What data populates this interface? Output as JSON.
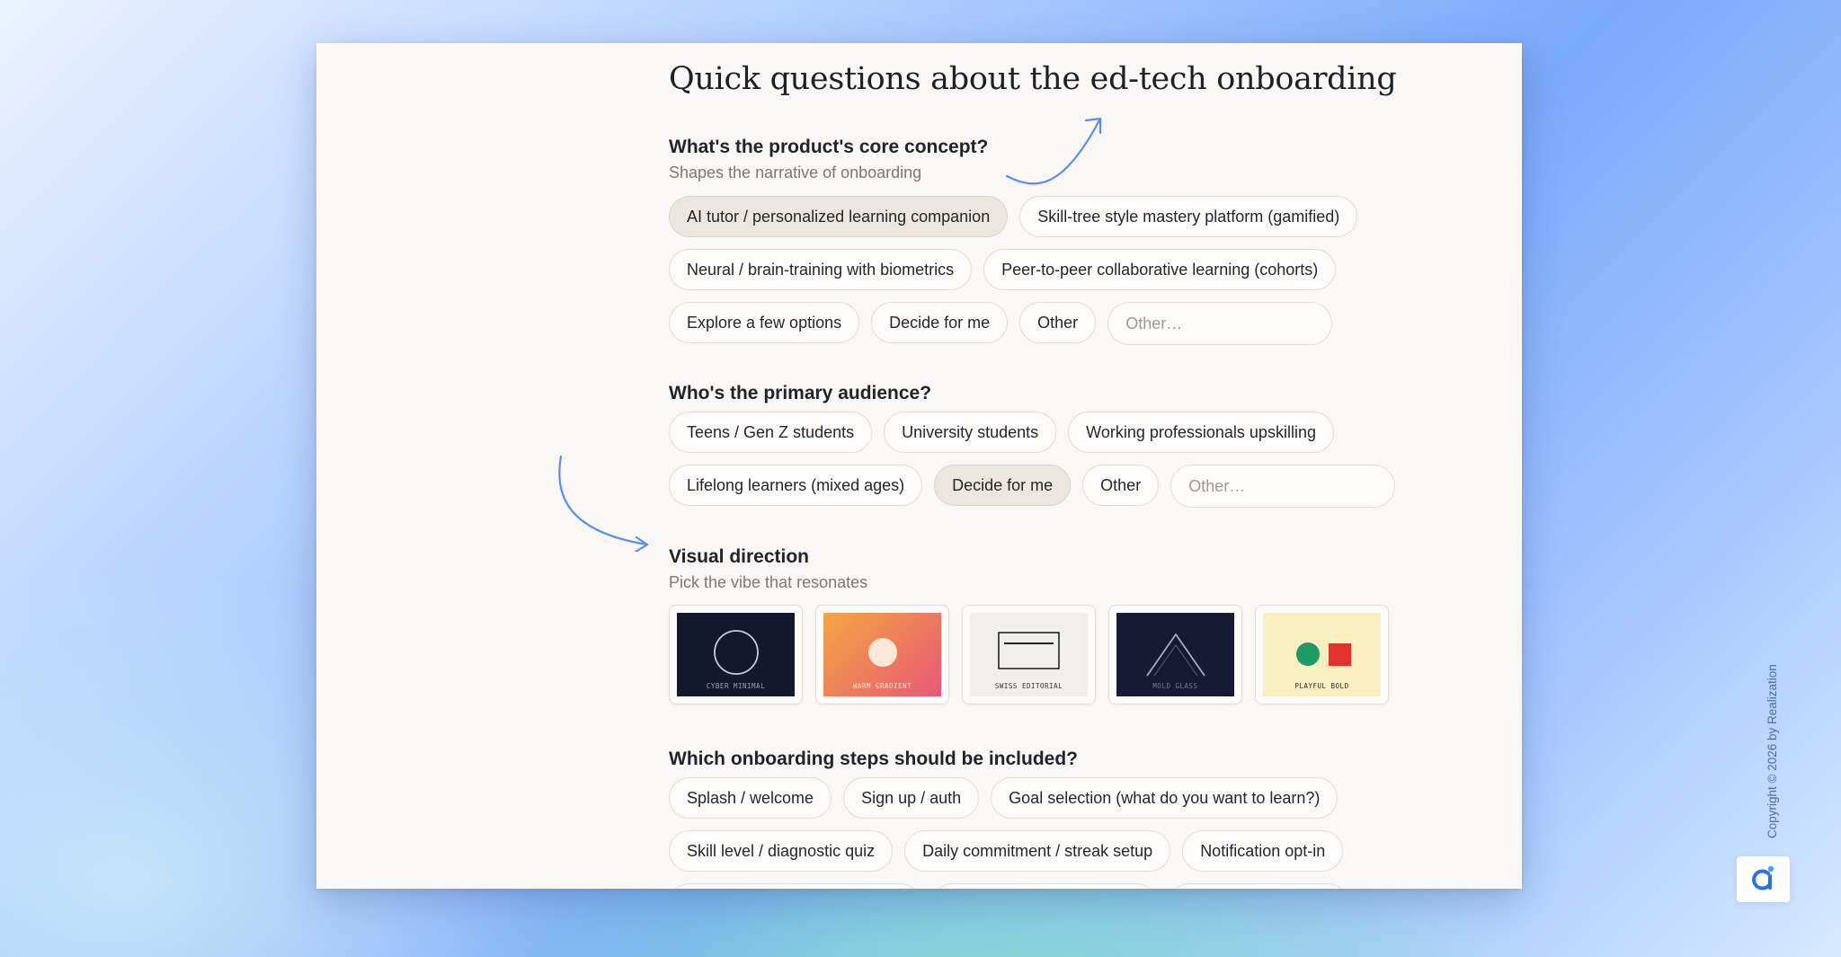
{
  "title": "Quick questions about the ed-tech onboarding",
  "questions": {
    "concept": {
      "title": "What's the product's core concept?",
      "subtitle": "Shapes the narrative of onboarding",
      "options": [
        "AI tutor / personalized learning companion",
        "Skill-tree style mastery platform (gamified)",
        "Neural / brain-training with biometrics",
        "Peer-to-peer collaborative learning (cohorts)",
        "Explore a few options",
        "Decide for me",
        "Other"
      ],
      "selected": "AI tutor / personalized learning companion",
      "other_placeholder": "Other…"
    },
    "audience": {
      "title": "Who's the primary audience?",
      "options": [
        "Teens / Gen Z students",
        "University students",
        "Working professionals upskilling",
        "Lifelong learners (mixed ages)",
        "Decide for me",
        "Other"
      ],
      "selected": "Decide for me",
      "other_placeholder": "Other…"
    },
    "visual": {
      "title": "Visual direction",
      "subtitle": "Pick the vibe that resonates",
      "styles": [
        {
          "label": "CYBER MINIMAL",
          "icon": "circle-outline",
          "bg": "#14182e",
          "fg": "#c9cbd6"
        },
        {
          "label": "WARM GRADIENT",
          "icon": "filled-circle",
          "bg_from": "#f5a646",
          "bg_to": "#e8587a",
          "fg": "#fde8d8"
        },
        {
          "label": "SWISS EDITORIAL",
          "icon": "rectangle-with-line",
          "bg": "#f1efed",
          "fg": "#222222"
        },
        {
          "label": "MOLD GLASS",
          "icon": "chevron-up",
          "bg": "#161a33",
          "fg": "#a7aab8"
        },
        {
          "label": "PLAYFUL BOLD",
          "icon": "circle-and-square",
          "bg": "#faefc1",
          "fg": "#2a2a2a",
          "circle": "#1e9a64",
          "square": "#e1332b"
        }
      ]
    },
    "steps": {
      "title": "Which onboarding steps should be included?",
      "options": [
        "Splash / welcome",
        "Sign up / auth",
        "Goal selection (what do you want to learn?)",
        "Skill level / diagnostic quiz",
        "Daily commitment / streak setup",
        "Notification opt-in"
      ]
    }
  },
  "copyright": "Copyright © 2026 by Realization",
  "colors": {
    "accent": "#5b8def",
    "selected_chip": "#ebe7e0",
    "window_bg": "#faf8f6"
  },
  "icons": {
    "decor_arrow_top": "curved-arrow-up-right",
    "decor_arrow_left": "curved-arrow-right",
    "logo": "realization-logo"
  }
}
